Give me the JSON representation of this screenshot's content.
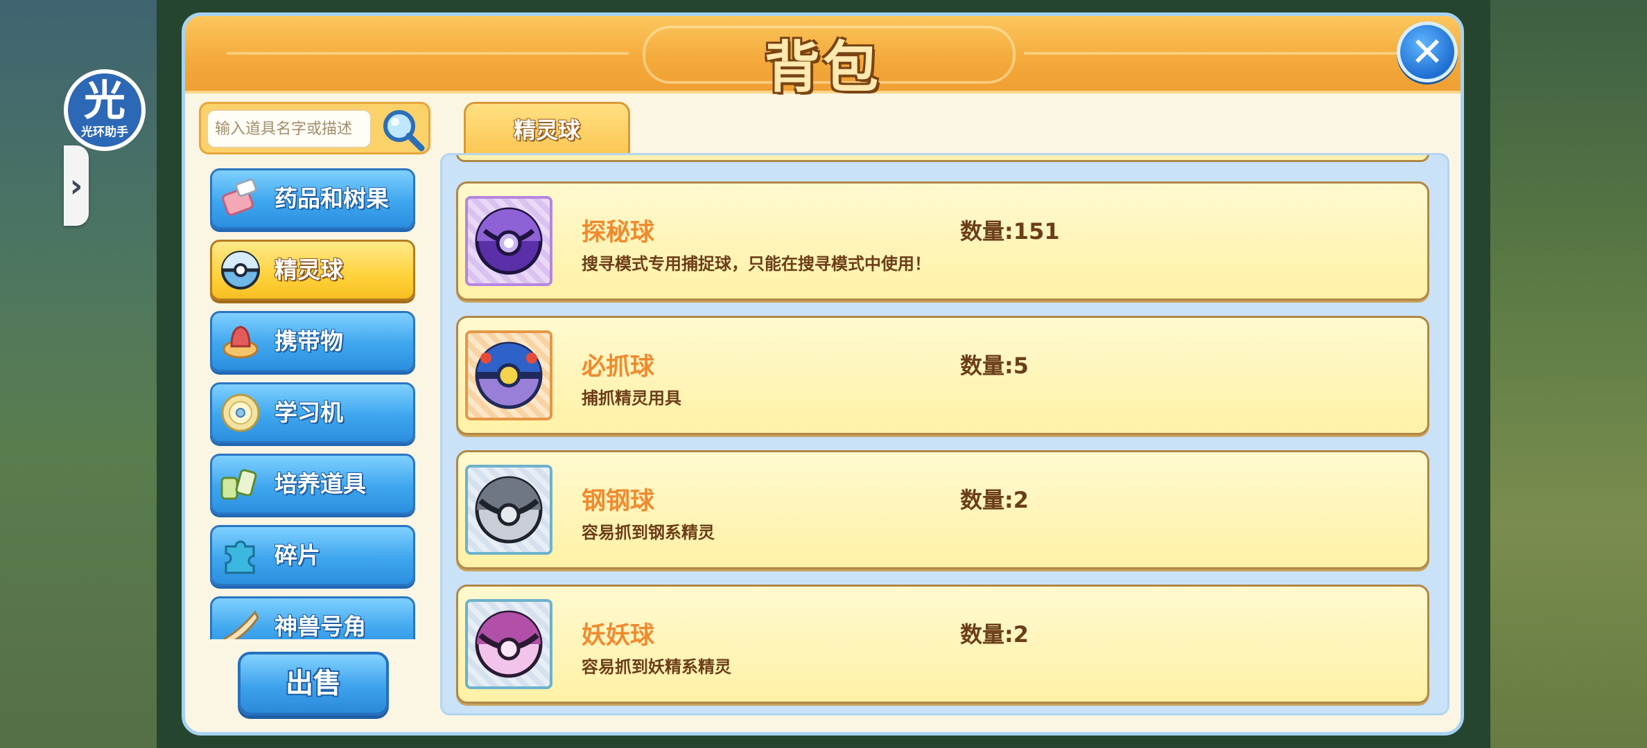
{
  "assistant": {
    "glyph": "光",
    "label": "光环助手",
    "expand_glyph": "›"
  },
  "panel": {
    "title": "背包",
    "close_glyph": "✕"
  },
  "search": {
    "placeholder": "输入道具名字或描述"
  },
  "categories": [
    {
      "label": "药品和树果",
      "icon": "potion-icon",
      "active": false
    },
    {
      "label": "精灵球",
      "icon": "pokeball-icon",
      "active": true
    },
    {
      "label": "携带物",
      "icon": "held-item-icon",
      "active": false
    },
    {
      "label": "学习机",
      "icon": "disc-icon",
      "active": false
    },
    {
      "label": "培养道具",
      "icon": "training-item-icon",
      "active": false
    },
    {
      "label": "碎片",
      "icon": "puzzle-piece-icon",
      "active": false
    },
    {
      "label": "神兽号角",
      "icon": "horn-icon",
      "active": false
    }
  ],
  "sell_button": "出售",
  "tab": {
    "label": "精灵球"
  },
  "items": [
    {
      "name": "探秘球",
      "quantity": "数量:151",
      "description": "搜寻模式专用捕捉球，只能在搜寻模式中使用！",
      "icon": "explore-ball-icon"
    },
    {
      "name": "必抓球",
      "quantity": "数量:5",
      "description": "捕抓精灵用具",
      "icon": "master-catch-ball-icon"
    },
    {
      "name": "钢钢球",
      "quantity": "数量:2",
      "description": "容易抓到钢系精灵",
      "icon": "steel-ball-icon"
    },
    {
      "name": "妖妖球",
      "quantity": "数量:2",
      "description": "容易抓到妖精系精灵",
      "icon": "fairy-ball-icon"
    }
  ]
}
